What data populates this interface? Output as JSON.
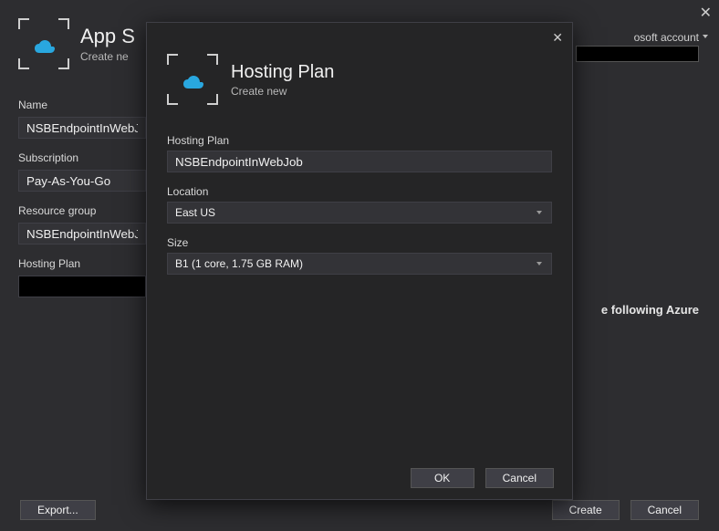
{
  "bg": {
    "title": "App S",
    "subtitle": "Create ne",
    "account_text_fragment": "osoft account",
    "name_label": "Name",
    "name_value": "NSBEndpointInWebJob",
    "subscription_label": "Subscription",
    "subscription_value": "Pay-As-You-Go",
    "resource_group_label": "Resource group",
    "resource_group_value": "NSBEndpointInWebJob*",
    "hosting_plan_label": "Hosting Plan",
    "right_text_fragment": "e following Azure",
    "export_btn": "Export...",
    "create_btn": "Create",
    "cancel_btn": "Cancel"
  },
  "dlg": {
    "title": "Hosting Plan",
    "subtitle": "Create new",
    "hosting_plan_label": "Hosting Plan",
    "hosting_plan_value": "NSBEndpointInWebJob",
    "location_label": "Location",
    "location_value": "East US",
    "size_label": "Size",
    "size_value": "B1 (1 core, 1.75 GB RAM)",
    "ok_btn": "OK",
    "cancel_btn": "Cancel"
  }
}
